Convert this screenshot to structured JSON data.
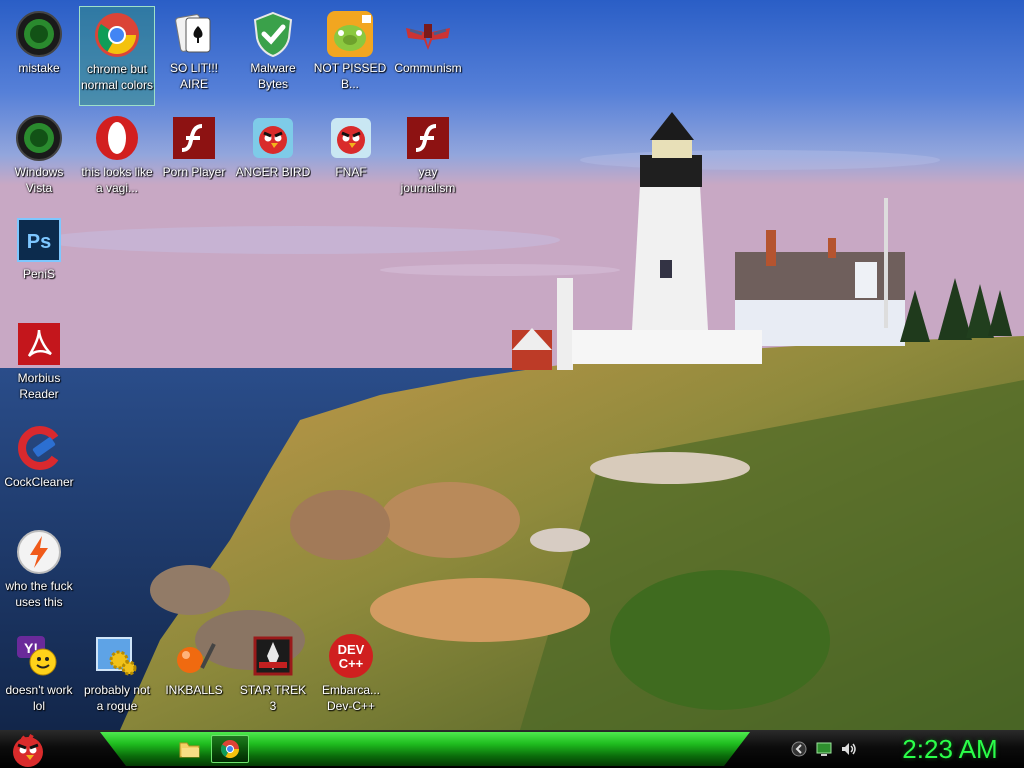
{
  "desktop": {
    "icons": [
      {
        "name": "mistake",
        "label": "mistake",
        "type": "xbox-green-orb"
      },
      {
        "name": "chrome",
        "label": "chrome but normal colors",
        "type": "chrome-icon",
        "selected": true
      },
      {
        "name": "solitaire",
        "label": "SO LIT!!! AIRE",
        "type": "solitaire-cards-icon"
      },
      {
        "name": "malwarebytes",
        "label": "Malware Bytes",
        "type": "shield-check-icon"
      },
      {
        "name": "not-pissed",
        "label": "NOT PISSED B...",
        "type": "angry-birds-pig-icon"
      },
      {
        "name": "communism",
        "label": "Communism",
        "type": "winged-emblem-icon"
      },
      {
        "name": "windows-vista",
        "label": "Windows Vista",
        "type": "xbox-green-orb"
      },
      {
        "name": "opera",
        "label": "this looks like a vagi...",
        "type": "opera-icon"
      },
      {
        "name": "porn-player",
        "label": "Porn Player",
        "type": "flash-icon"
      },
      {
        "name": "anger-bird",
        "label": "ANGER BIRD",
        "type": "angry-bird-red-icon"
      },
      {
        "name": "fnaf",
        "label": "FNAF",
        "type": "angry-bird-red-icon"
      },
      {
        "name": "yay-journalism",
        "label": "yay journalism",
        "type": "flash-icon"
      },
      {
        "name": "penis",
        "label": "PeniS",
        "type": "photoshop-icon"
      },
      {
        "name": "morbius-reader",
        "label": "Morbius Reader",
        "type": "acrobat-icon"
      },
      {
        "name": "cockcleaner",
        "label": "CockCleaner",
        "type": "ccleaner-icon"
      },
      {
        "name": "who-uses-this",
        "label": "who the fuck uses this",
        "type": "winamp-bolt-icon"
      },
      {
        "name": "yahoo-messenger",
        "label": "doesn't work lol",
        "type": "yahoo-messenger-icon"
      },
      {
        "name": "probably-not-rogue",
        "label": "probably not a rogue",
        "type": "gears-window-icon"
      },
      {
        "name": "inkballs",
        "label": "INKBALLS",
        "type": "inkball-icon"
      },
      {
        "name": "star-trek-3",
        "label": "STAR TREK 3",
        "type": "star-trek-icon"
      },
      {
        "name": "dev-cpp",
        "label": "Embarca... Dev-C++",
        "type": "devcpp-icon"
      }
    ]
  },
  "devcpp_icon_text": {
    "line1": "DEV",
    "line2": "C++"
  },
  "photoshop_icon_text": "Ps",
  "taskbar": {
    "start_icon": "angry-bird-start-icon",
    "pinned": [
      {
        "name": "file-explorer",
        "icon": "folder-icon"
      },
      {
        "name": "chrome",
        "icon": "chrome-icon",
        "active": true
      }
    ],
    "tray_icons": [
      "network-arrow-icon",
      "monitor-icon",
      "volume-icon"
    ],
    "clock": "2:23 AM"
  },
  "colors": {
    "taskbar_green": "#1fbc1f",
    "clock_green": "#2bff4a",
    "selection": "#349678"
  }
}
